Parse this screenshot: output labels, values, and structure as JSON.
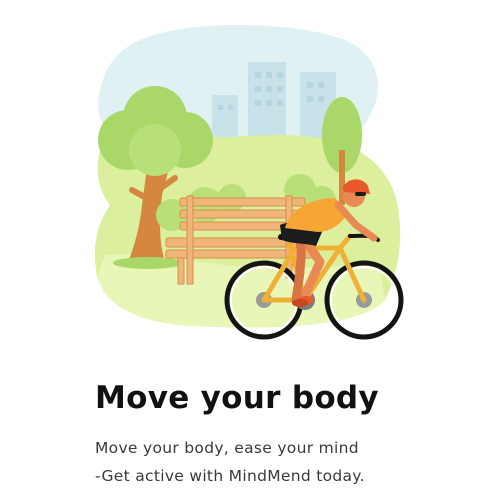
{
  "onboarding": {
    "title": "Move your body",
    "subtitle_line1": "Move your body, ease your mind",
    "subtitle_line2": "-Get active with MindMend today."
  },
  "illustration": {
    "icon": "park-cyclist-illustration",
    "colors": {
      "sky": "#dff1f3",
      "grass": "#dcef9c",
      "tree": "#a9d869",
      "trunk": "#d6873f",
      "bench": "#f0b578",
      "tire": "#141414",
      "shirt": "#f7a535"
    }
  }
}
